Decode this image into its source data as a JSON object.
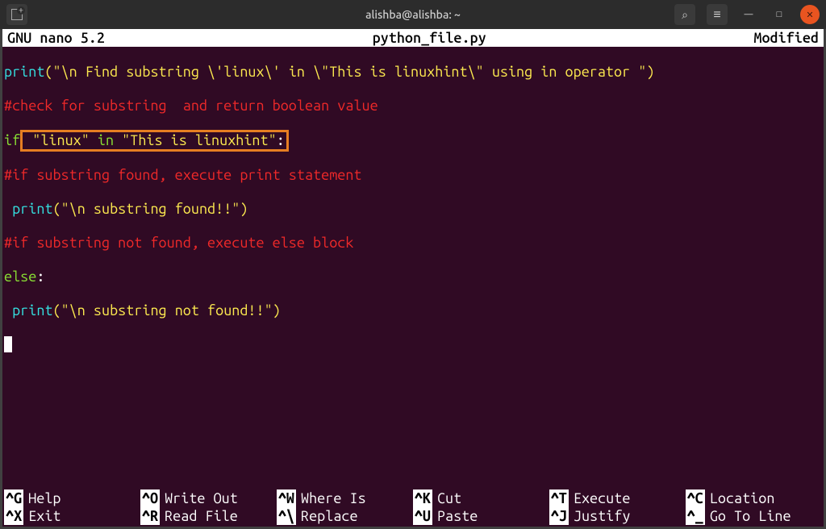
{
  "titlebar": {
    "title": "alishba@alishba: ~"
  },
  "nano": {
    "app": "  GNU nano 5.2",
    "filename": "python_file.py",
    "status": "Modified "
  },
  "code": {
    "l1_print": "print",
    "l1_a": "(",
    "l1_str": "\"\\n Find substring \\'linux\\' in \\\"This is linuxhint\\\" using in operator \"",
    "l1_b": ")",
    "l2": "#check for substring  and return boolean value",
    "l3_if": "if",
    "l3_sp1": " ",
    "l3_s1": "\"linux\"",
    "l3_in": " in ",
    "l3_s2": "\"This is linuxhint\"",
    "l3_colon": ":",
    "l4": "#if substring found, execute print statement",
    "l5_sp": " ",
    "l5_print": "print",
    "l5_a": "(",
    "l5_str": "\"\\n substring found!!\"",
    "l5_b": ")",
    "l6": "#if substring not found, execute else block",
    "l7_else": "else",
    "l7_colon": ":",
    "l8_sp": " ",
    "l8_print": "print",
    "l8_a": "(",
    "l8_str": "\"\\n substring not found!!\"",
    "l8_b": ")"
  },
  "shortcuts": {
    "row1": [
      {
        "key": "^G",
        "label": "Help"
      },
      {
        "key": "^O",
        "label": "Write Out"
      },
      {
        "key": "^W",
        "label": "Where Is"
      },
      {
        "key": "^K",
        "label": "Cut"
      },
      {
        "key": "^T",
        "label": "Execute"
      },
      {
        "key": "^C",
        "label": "Location"
      }
    ],
    "row2": [
      {
        "key": "^X",
        "label": "Exit"
      },
      {
        "key": "^R",
        "label": "Read File"
      },
      {
        "key": "^\\",
        "label": "Replace"
      },
      {
        "key": "^U",
        "label": "Paste"
      },
      {
        "key": "^J",
        "label": "Justify"
      },
      {
        "key": "^_",
        "label": "Go To Line"
      }
    ]
  }
}
